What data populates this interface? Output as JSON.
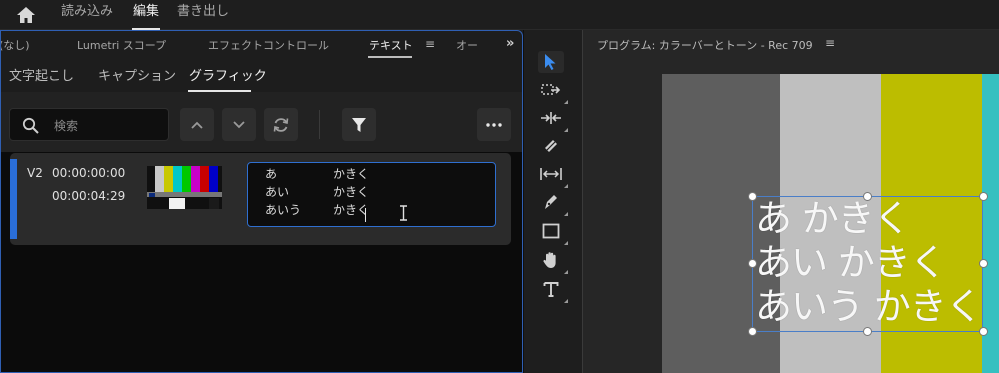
{
  "topbar": {
    "home_icon": "home-icon",
    "tabs": [
      "読み込み",
      "編集",
      "書き出し"
    ],
    "active_tab": "編集"
  },
  "left_panel": {
    "tabs": [
      "(なし)",
      "Lumetri スコープ",
      "エフェクトコントロール",
      "テキスト",
      "オー"
    ],
    "active_tab": "テキスト",
    "menu_glyph": "≡",
    "overflow_glyph": "»",
    "subtabs": [
      "文字起こし",
      "キャプション",
      "グラフィック"
    ],
    "active_subtab": "グラフィック",
    "search_placeholder": "検索",
    "row": {
      "track": "V2",
      "timecode_in": "00:00:00:00",
      "timecode_out": "00:00:04:29",
      "text_lines": [
        {
          "col1": "あ",
          "col2": "かきく"
        },
        {
          "col1": "あい",
          "col2": "かきく"
        },
        {
          "col1": "あいう",
          "col2": "かきく"
        }
      ]
    }
  },
  "program": {
    "title": "プログラム: カラーバーとトーン - Rec 709",
    "menu_glyph": "≡",
    "bar_colors": [
      "#5e5e5e",
      "#bfbfbf",
      "#bcbd00",
      "#36c0c0"
    ],
    "overlay_lines": [
      "あ かきく",
      "あい かきく",
      "あいう かきく"
    ]
  },
  "colors": {
    "accent_blue": "#2f6fd0",
    "tool_active": "#3b8df0"
  }
}
